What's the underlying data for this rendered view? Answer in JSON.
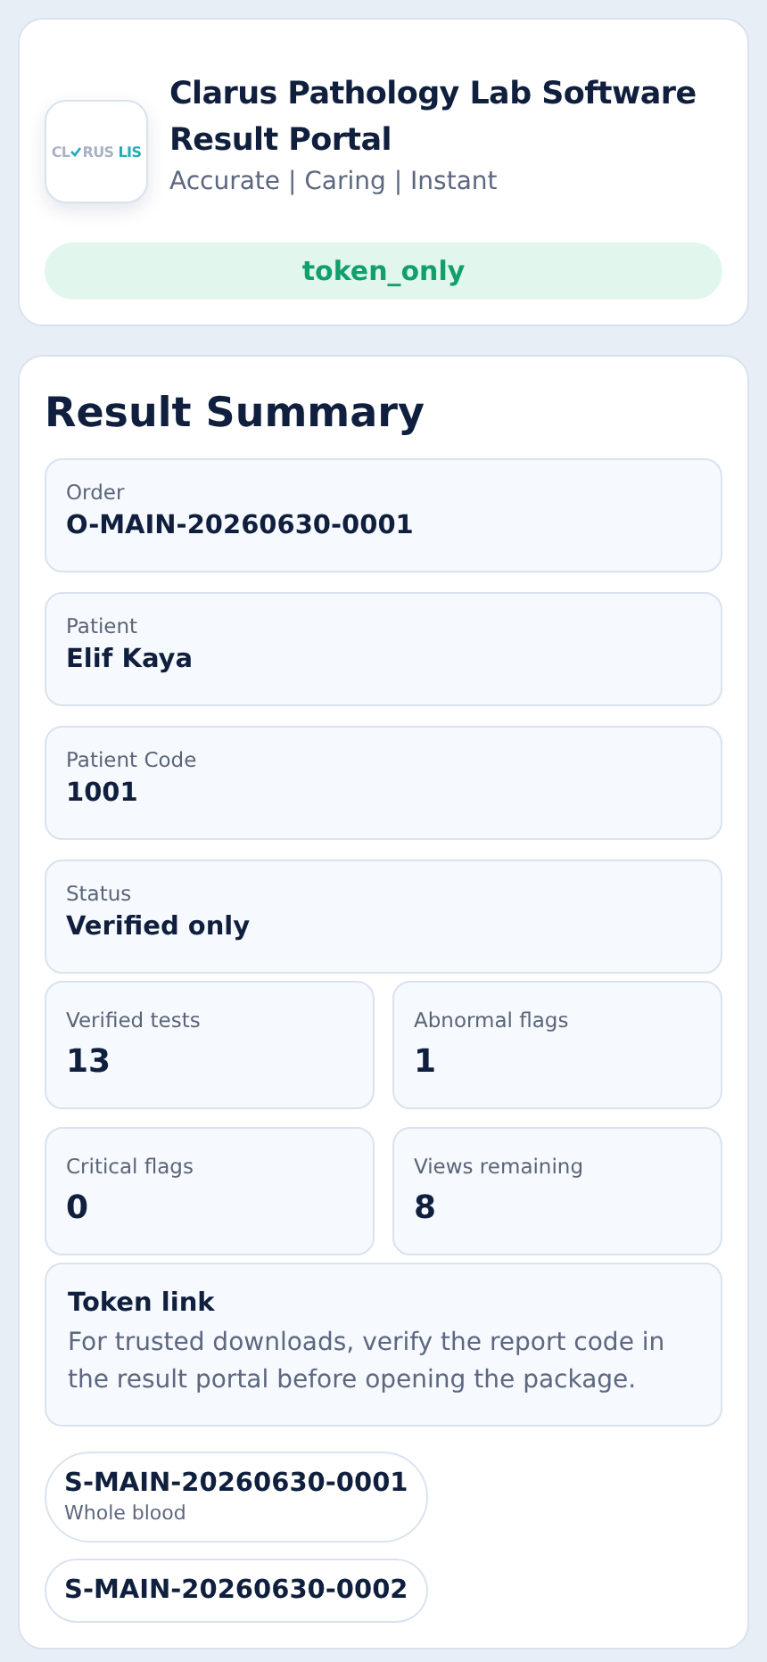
{
  "header": {
    "logo": {
      "left": "CL",
      "middle": "RUS",
      "accent": "LIS"
    },
    "title": "Clarus Pathology Lab Software Result Portal",
    "tagline": "Accurate | Caring | Instant",
    "access_mode": "token_only"
  },
  "summary": {
    "title": "Result Summary",
    "fields": [
      {
        "label": "Order",
        "value": "O-MAIN-20260630-0001"
      },
      {
        "label": "Patient",
        "value": "Elif Kaya"
      },
      {
        "label": "Patient Code",
        "value": "1001"
      },
      {
        "label": "Status",
        "value": "Verified only"
      }
    ],
    "stats": [
      {
        "label": "Verified tests",
        "value": "13"
      },
      {
        "label": "Abnormal flags",
        "value": "1"
      },
      {
        "label": "Critical flags",
        "value": "0"
      },
      {
        "label": "Views remaining",
        "value": "8"
      }
    ],
    "notice": {
      "title": "Token link",
      "text": "For trusted downloads, verify the report code in the result portal before opening the package."
    },
    "samples": [
      {
        "code": "S-MAIN-20260630-0001",
        "type": "Whole blood"
      },
      {
        "code": "S-MAIN-20260630-0002"
      }
    ]
  }
}
